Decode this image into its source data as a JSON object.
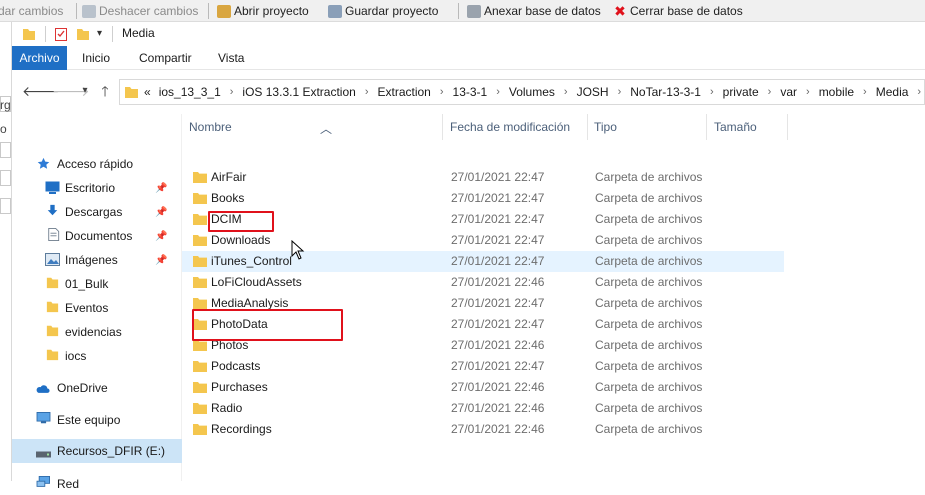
{
  "background_app": {
    "toolbar": {
      "item_partial": "dar cambios",
      "undo_label": "Deshacer cambios",
      "open_project_label": "Abrir proyecto",
      "save_project_label": "Guardar proyecto",
      "attach_db_label": "Anexar base de datos",
      "close_db_label": "Cerrar base de datos"
    },
    "left_fragments": [
      "rg",
      "o"
    ]
  },
  "explorer": {
    "title": "Media",
    "ribbon_tabs": [
      "Archivo",
      "Inicio",
      "Compartir",
      "Vista"
    ],
    "address": {
      "overflow": "«",
      "crumbs": [
        "ios_13_3_1",
        "iOS 13.3.1 Extraction",
        "Extraction",
        "13-3-1",
        "Volumes",
        "JOSH",
        "NoTar-13-3-1",
        "private",
        "var",
        "mobile",
        "Media"
      ]
    },
    "sidebar": {
      "quick_access": "Acceso rápido",
      "items": [
        {
          "label": "Escritorio",
          "icon": "desktop-icon",
          "pinned": true
        },
        {
          "label": "Descargas",
          "icon": "download-icon",
          "pinned": true
        },
        {
          "label": "Documentos",
          "icon": "documents-icon",
          "pinned": true
        },
        {
          "label": "Imágenes",
          "icon": "pictures-icon",
          "pinned": true
        },
        {
          "label": "01_Bulk",
          "icon": "folder-icon",
          "pinned": false
        },
        {
          "label": "Eventos",
          "icon": "folder-icon",
          "pinned": false
        },
        {
          "label": "evidencias",
          "icon": "folder-icon",
          "pinned": false
        },
        {
          "label": "iocs",
          "icon": "folder-icon",
          "pinned": false
        }
      ],
      "onedrive": "OneDrive",
      "this_pc": "Este equipo",
      "drive": "Recursos_DFIR (E:)",
      "network": "Red"
    },
    "columns": {
      "name": "Nombre",
      "modified": "Fecha de modificación",
      "type": "Tipo",
      "size": "Tamaño"
    },
    "files": [
      {
        "name": "AirFair",
        "date": "27/01/2021 22:47",
        "type": "Carpeta de archivos"
      },
      {
        "name": "Books",
        "date": "27/01/2021 22:47",
        "type": "Carpeta de archivos"
      },
      {
        "name": "DCIM",
        "date": "27/01/2021 22:47",
        "type": "Carpeta de archivos"
      },
      {
        "name": "Downloads",
        "date": "27/01/2021 22:47",
        "type": "Carpeta de archivos"
      },
      {
        "name": "iTunes_Control",
        "date": "27/01/2021 22:47",
        "type": "Carpeta de archivos"
      },
      {
        "name": "LoFiCloudAssets",
        "date": "27/01/2021 22:46",
        "type": "Carpeta de archivos"
      },
      {
        "name": "MediaAnalysis",
        "date": "27/01/2021 22:47",
        "type": "Carpeta de archivos"
      },
      {
        "name": "PhotoData",
        "date": "27/01/2021 22:47",
        "type": "Carpeta de archivos"
      },
      {
        "name": "Photos",
        "date": "27/01/2021 22:46",
        "type": "Carpeta de archivos"
      },
      {
        "name": "Podcasts",
        "date": "27/01/2021 22:47",
        "type": "Carpeta de archivos"
      },
      {
        "name": "Purchases",
        "date": "27/01/2021 22:46",
        "type": "Carpeta de archivos"
      },
      {
        "name": "Radio",
        "date": "27/01/2021 22:46",
        "type": "Carpeta de archivos"
      },
      {
        "name": "Recordings",
        "date": "27/01/2021 22:46",
        "type": "Carpeta de archivos"
      }
    ],
    "colors": {
      "accent": "#1f6fc5",
      "folder": "#f4c64e",
      "highlight": "#e0111b",
      "hover_row": "#e5f3ff",
      "selected_nav": "#cce4f7"
    }
  }
}
